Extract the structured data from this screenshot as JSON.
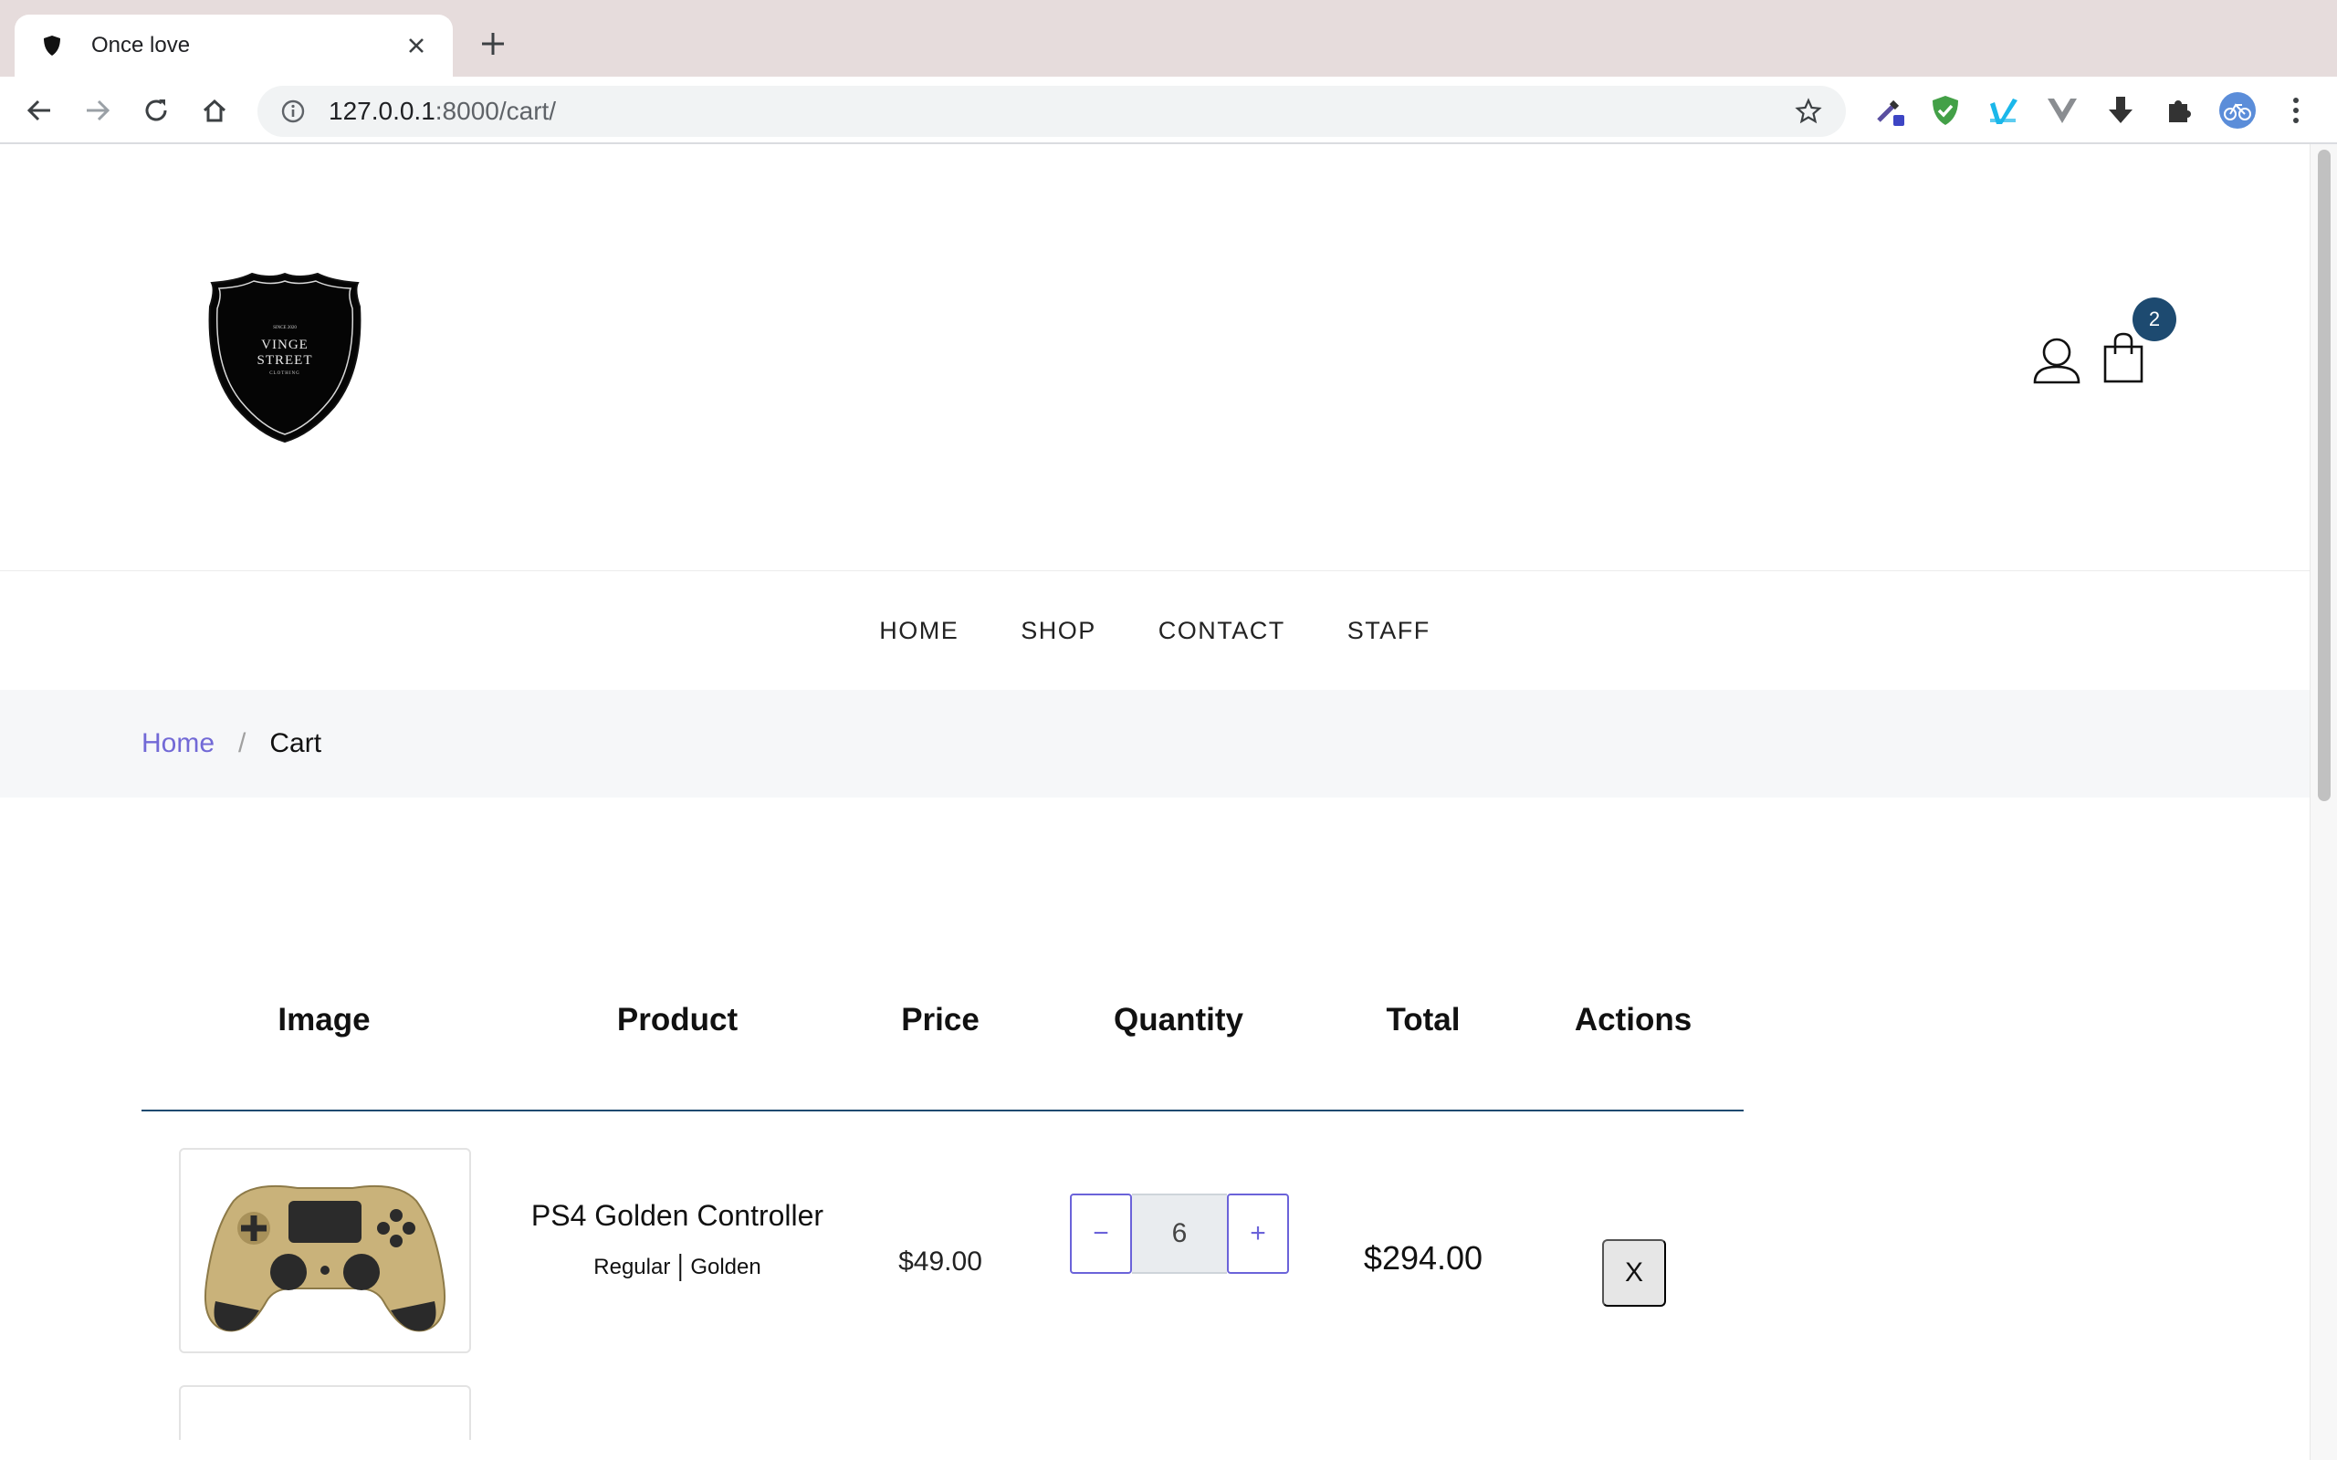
{
  "browser": {
    "tab_title": "Once love",
    "url_host": "127.0.0.1",
    "url_rest": ":8000/cart/",
    "icons": [
      "shield-favicon-icon",
      "close-icon",
      "plus-icon",
      "back-arrow-icon",
      "forward-arrow-icon",
      "reload-icon",
      "home-icon",
      "info-icon",
      "star-icon",
      "eyedropper-icon",
      "shield-check-icon",
      "vimeo-icon",
      "vue-icon",
      "download-icon",
      "puzzle-icon",
      "profile-avatar-icon",
      "kebab-menu-icon"
    ]
  },
  "header": {
    "logo_text": {
      "line1": "SINCE 2020",
      "line2": "VINGE",
      "line3": "STREET",
      "line4": "CLOTHING"
    },
    "cart_count": "2"
  },
  "nav": {
    "items": [
      "HOME",
      "SHOP",
      "CONTACT",
      "STAFF"
    ]
  },
  "breadcrumb": {
    "home": "Home",
    "separator": "/",
    "current": "Cart"
  },
  "cart": {
    "columns": [
      "Image",
      "Product",
      "Price",
      "Quantity",
      "Total",
      "Actions"
    ],
    "items": [
      {
        "name": "PS4 Golden Controller",
        "size": "Regular",
        "color": "Golden",
        "price": "$49.00",
        "quantity": "6",
        "total": "$294.00",
        "decrement_label": "−",
        "increment_label": "+",
        "remove_label": "X"
      }
    ]
  },
  "colors": {
    "accent": "#6b63d9",
    "badge": "#1d4a70",
    "breadcrumb_bg": "#f6f7f9",
    "tabstrip": "#e6dcdc"
  }
}
